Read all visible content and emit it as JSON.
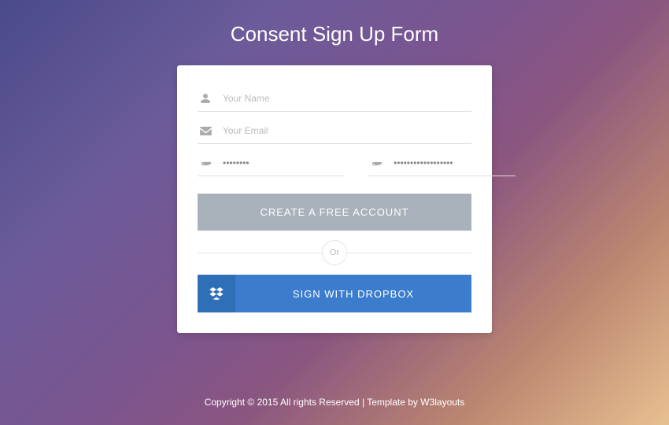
{
  "title": "Consent Sign Up Form",
  "form": {
    "name_placeholder": "Your Name",
    "email_placeholder": "Your Email",
    "password_value": "••••••••",
    "confirm_value": "••••••••••••••••••",
    "create_label": "CREATE A FREE ACCOUNT",
    "divider_label": "Or",
    "dropbox_label": "SIGN WITH DROPBOX"
  },
  "footer": {
    "copyright": "Copyright © 2015 All rights Reserved | Template by ",
    "link_text": "W3layouts"
  }
}
